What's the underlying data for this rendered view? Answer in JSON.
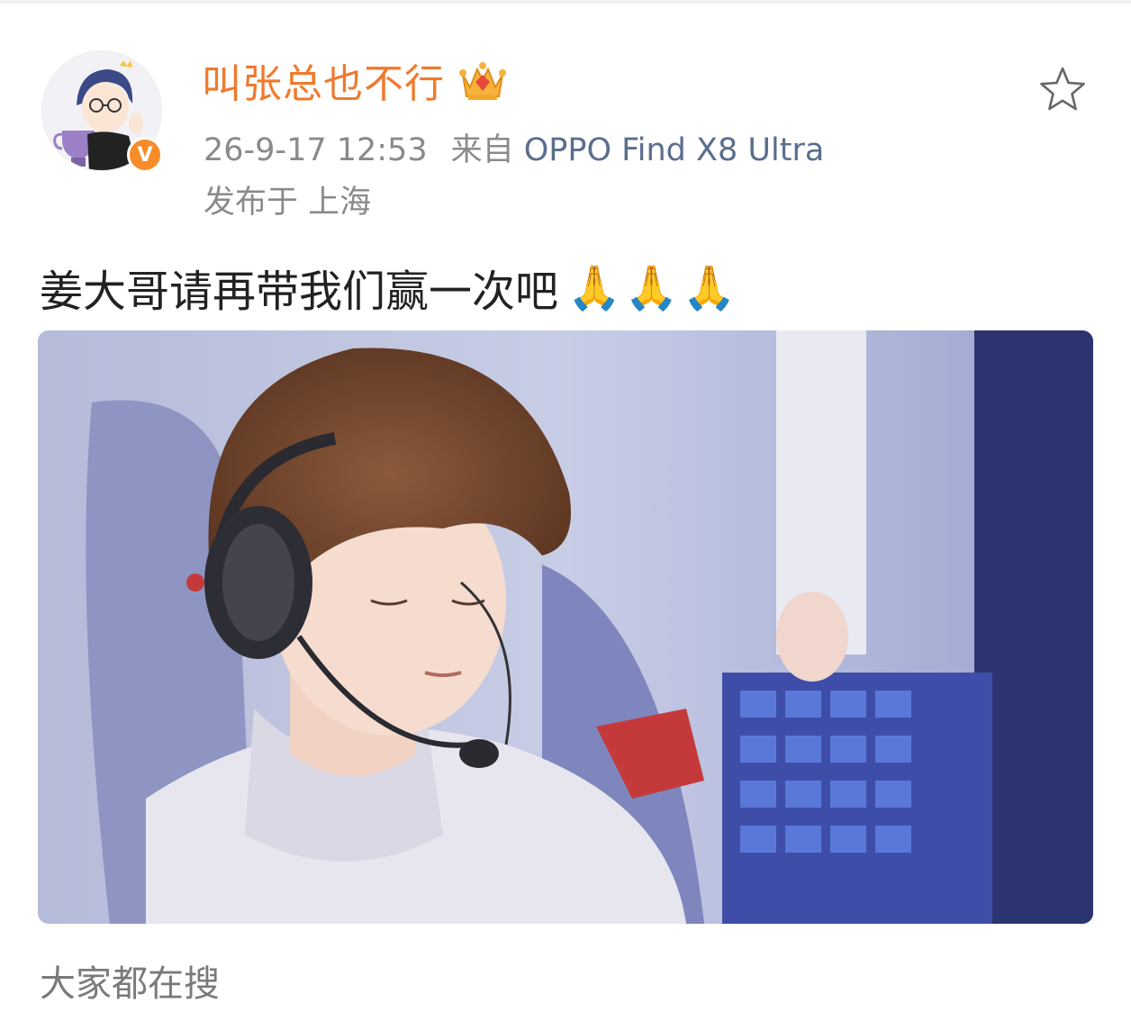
{
  "post": {
    "author": {
      "name": "叫张总也不行",
      "verified_badge": "V",
      "crown_icon": "crown-icon",
      "avatar_icon": "avatar"
    },
    "timestamp": "26-9-17 12:53",
    "source_prefix": "来自",
    "source_device": "OPPO Find X8 Ultra",
    "location": "发布于 上海",
    "text": "姜大哥请再带我们赢一次吧",
    "emojis": [
      "🙏",
      "🙏",
      "🙏"
    ],
    "favorite_icon": "star-icon"
  },
  "section": {
    "trending_label": "大家都在搜"
  },
  "colors": {
    "username": "#f0792d",
    "verified": "#f78c2a",
    "source_link": "#5a6e8e",
    "meta_text": "#8a8a8a",
    "body_text": "#222222"
  }
}
